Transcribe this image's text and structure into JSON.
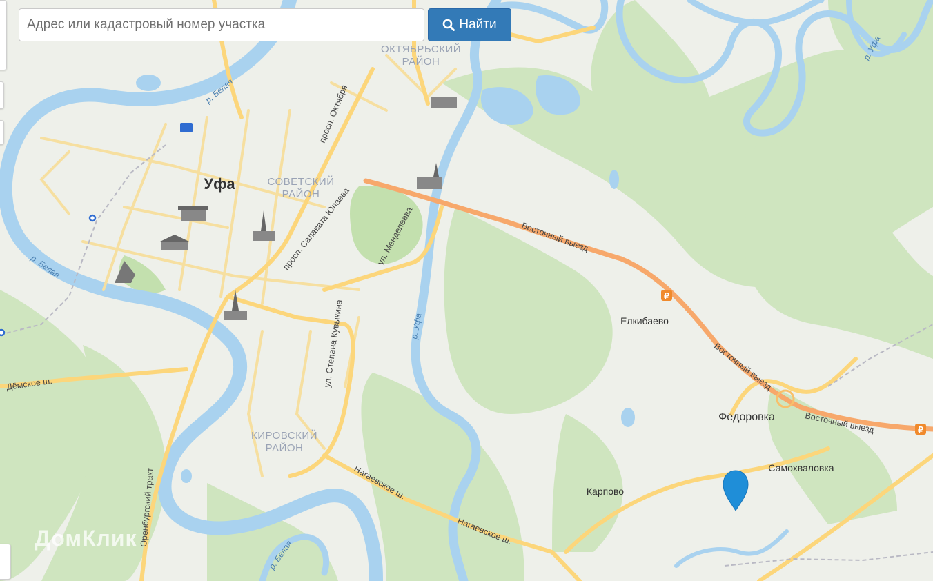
{
  "search": {
    "placeholder": "Адрес или кадастровый номер участка",
    "value": "",
    "button_label": "Найти",
    "button_icon": "search-icon"
  },
  "map": {
    "city_label": "Уфа",
    "districts": [
      {
        "line1": "ОКТЯБРЬСКИЙ",
        "line2": "РАЙОН"
      },
      {
        "line1": "СОВЕТСКИЙ",
        "line2": "РАЙОН"
      },
      {
        "line1": "КИРОВСКИЙ",
        "line2": "РАЙОН"
      }
    ],
    "places": [
      "Елкибаево",
      "Фёдоровка",
      "Самохваловка",
      "Карпово"
    ],
    "streets": [
      "просп. Октября",
      "просп. Салавата Юлаева",
      "ул. Менделеева",
      "ул. Степана Кувыкина",
      "Восточный выезд",
      "Восточный выезд",
      "Восточный выезд",
      "Дёмское ш.",
      "Оренбургский тракт",
      "Нагаевское ш.",
      "Нагаевское ш."
    ],
    "rivers": [
      "р. Белая",
      "р. Белая",
      "р. Белая",
      "р. Уфа",
      "р. Уфа"
    ],
    "toll_symbol": "₽",
    "marker_icon": "location-pin-icon",
    "watermark": "ДомКлик",
    "colors": {
      "water": "#a9d2ef",
      "forest": "#cfe5bf",
      "highway": "#f7a86b",
      "road": "#fbd77a",
      "marker": "#1f8ed8",
      "button": "#337ab7"
    }
  }
}
